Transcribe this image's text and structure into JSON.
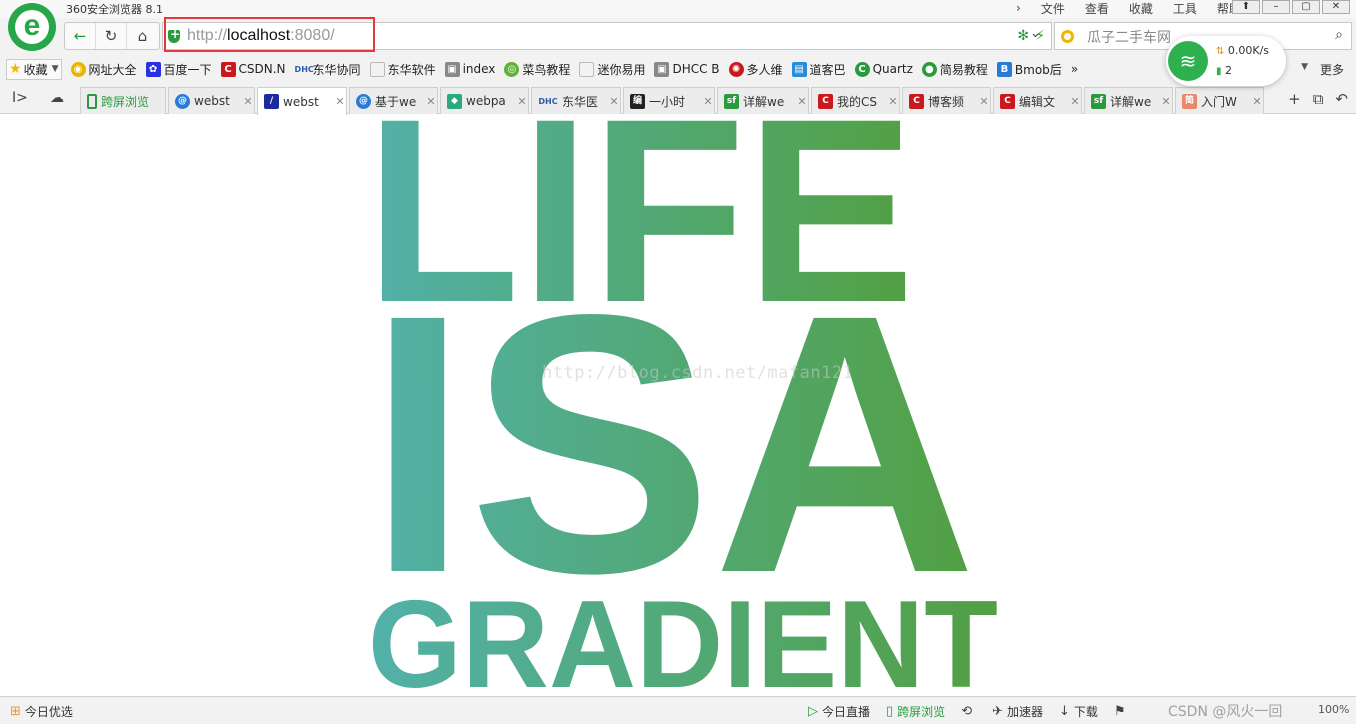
{
  "window": {
    "title": "360安全浏览器 8.1",
    "menu": [
      "文件",
      "查看",
      "收藏",
      "工具",
      "帮助"
    ],
    "logo_letter": "e"
  },
  "nav": {
    "back_icon": "arrow-left-icon",
    "reload_icon": "reload-icon",
    "home_icon": "home-icon"
  },
  "address": {
    "scheme": "http://",
    "host": "localhost",
    "port": ":8080/"
  },
  "search": {
    "placeholder": "瓜子二手车网"
  },
  "bookmarks": {
    "favorites_label": "收藏",
    "items": [
      {
        "label": "网址大全",
        "icon": "globe-icon",
        "color": "#e8b400"
      },
      {
        "label": "百度一下",
        "icon": "baidu-paw-icon",
        "color": "#2932e1"
      },
      {
        "label": "CSDN.N",
        "icon": "csdn-icon",
        "color": "#c9191d"
      },
      {
        "label": "东华协同",
        "icon": "dhc-icon",
        "color": "#2a5caa"
      },
      {
        "label": "东华软件",
        "icon": "page-icon",
        "color": "#999999"
      },
      {
        "label": "index",
        "icon": "image-icon",
        "color": "#666666"
      },
      {
        "label": "菜鸟教程",
        "icon": "runoob-icon",
        "color": "#5fb336"
      },
      {
        "label": "迷你易用",
        "icon": "page-icon",
        "color": "#999999"
      },
      {
        "label": "DHCC B",
        "icon": "image-icon",
        "color": "#666666"
      },
      {
        "label": "多人维",
        "icon": "multiuser-icon",
        "color": "#c9191d"
      },
      {
        "label": "道客巴",
        "icon": "doc88-icon",
        "color": "#2a8bd6"
      },
      {
        "label": "Quartz",
        "icon": "quartz-icon",
        "color": "#2a9b3d"
      },
      {
        "label": "简易教程",
        "icon": "wechat-icon",
        "color": "#2a9b3d"
      },
      {
        "label": "Bmob后",
        "icon": "bmob-icon",
        "color": "#2a7bd6"
      }
    ],
    "more_label": "更多"
  },
  "tabs": [
    {
      "label": "跨屏浏览",
      "icon": "phone-icon",
      "color": "#2a9b3d",
      "closable": false,
      "active": false
    },
    {
      "label": "webst",
      "icon": "webstorm-icon",
      "color": "#2a7bd6",
      "closable": true,
      "active": false
    },
    {
      "label": "webst",
      "icon": "webstorm-icon",
      "color": "#1b2a9e",
      "closable": true,
      "active": true
    },
    {
      "label": "基于we",
      "icon": "webstorm-icon",
      "color": "#2a7bd6",
      "closable": true,
      "active": false
    },
    {
      "label": "webpa",
      "icon": "webpack-icon",
      "color": "#2aa880",
      "closable": true,
      "active": false
    },
    {
      "label": "东华医",
      "icon": "dhc-icon",
      "color": "#2a5caa",
      "closable": true,
      "active": false
    },
    {
      "label": "一小时",
      "icon": "bian-icon",
      "color": "#222222",
      "closable": true,
      "active": false
    },
    {
      "label": "详解we",
      "icon": "sf-icon",
      "color": "#2a9b3d",
      "closable": true,
      "active": false
    },
    {
      "label": "我的CS",
      "icon": "csdn-icon",
      "color": "#c9191d",
      "closable": true,
      "active": false
    },
    {
      "label": "博客频",
      "icon": "csdn-icon",
      "color": "#c9191d",
      "closable": true,
      "active": false
    },
    {
      "label": "编辑文",
      "icon": "csdn-icon",
      "color": "#c9191d",
      "closable": true,
      "active": false
    },
    {
      "label": "详解we",
      "icon": "sf-icon",
      "color": "#2a9b3d",
      "closable": true,
      "active": false
    },
    {
      "label": "入门W",
      "icon": "jianshu-icon",
      "color": "#e9876a",
      "closable": true,
      "active": false
    }
  ],
  "page": {
    "line1": "LIFE",
    "line2": "ISA",
    "line3": "GRADIENT",
    "gradient_start": "#52b1a9",
    "gradient_end": "#52a043",
    "watermark": "http://blog.csdn.net/mafan121"
  },
  "network": {
    "speed": "0.00K/s",
    "connections": "2"
  },
  "status": {
    "left_label": "今日优选",
    "items": [
      {
        "label": "今日直播",
        "icon": "play-icon"
      },
      {
        "label": "跨屏浏览",
        "icon": "phone-icon"
      },
      {
        "label": "",
        "icon": "sync-icon"
      },
      {
        "label": "加速器",
        "icon": "rocket-icon"
      },
      {
        "label": "下载",
        "icon": "download-icon"
      }
    ],
    "zoom": "100%",
    "csdn_watermark": "CSDN @风火一回"
  }
}
